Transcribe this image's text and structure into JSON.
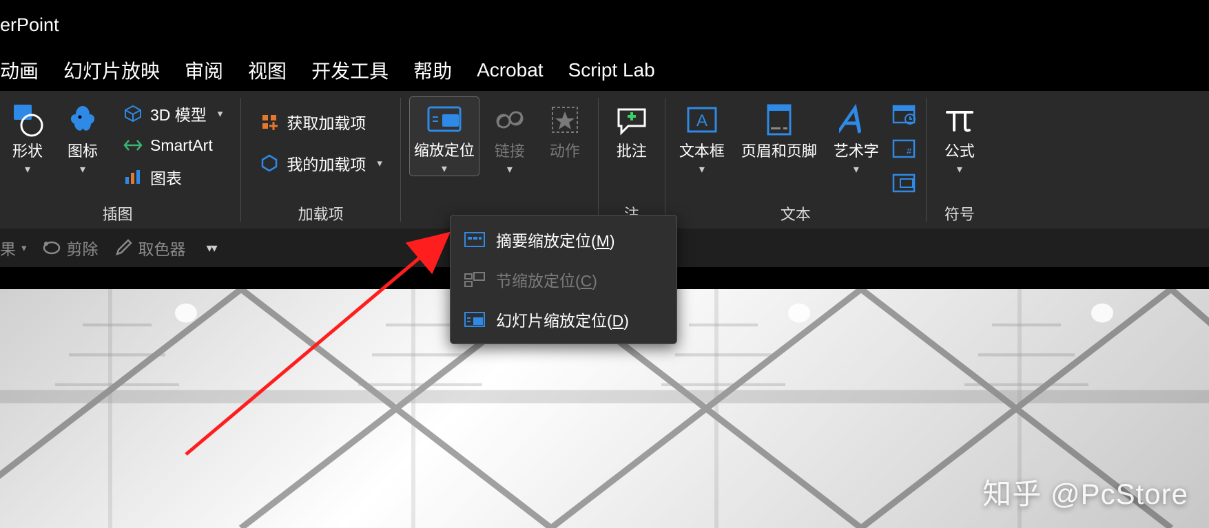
{
  "titlebar": {
    "app_fragment": "erPoint"
  },
  "tabs": [
    {
      "label": "动画"
    },
    {
      "label": "幻灯片放映"
    },
    {
      "label": "审阅"
    },
    {
      "label": "视图"
    },
    {
      "label": "开发工具"
    },
    {
      "label": "帮助"
    },
    {
      "label": "Acrobat"
    },
    {
      "label": "Script Lab"
    }
  ],
  "ribbon": {
    "groups": {
      "illustrations": {
        "label": "插图",
        "shapes": "形状",
        "icons": "图标",
        "model3d": "3D 模型",
        "smartart": "SmartArt",
        "chart": "图表"
      },
      "addins": {
        "label": "加载项",
        "get": "获取加载项",
        "my": "我的加载项"
      },
      "zoom_link": {
        "zoom": "缩放定位",
        "link": "链接",
        "action": "动作"
      },
      "comments": {
        "label": "注",
        "comment": "批注"
      },
      "text": {
        "label": "文本",
        "textbox": "文本框",
        "headerfooter": "页眉和页脚",
        "wordart": "艺术字"
      },
      "symbols": {
        "label": "符号",
        "equation": "公式"
      }
    }
  },
  "subbar": {
    "guo": "果",
    "crop": "剪除",
    "eyedrop": "取色器"
  },
  "menu": {
    "summary": "摘要缩放定位(",
    "summary_k": "M",
    "summary_end": ")",
    "section": "节缩放定位(",
    "section_k": "C",
    "section_end": ")",
    "slide": "幻灯片缩放定位(",
    "slide_k": "D",
    "slide_end": ")"
  },
  "watermark": "知乎 @PcStore"
}
